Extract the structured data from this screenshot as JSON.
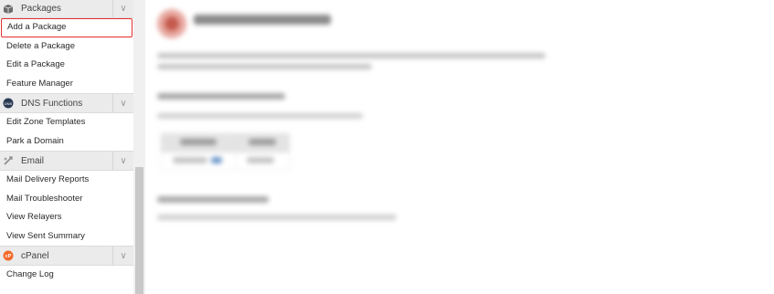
{
  "sidebar": {
    "sections": [
      {
        "id": "packages",
        "title": "Packages",
        "icon": "package-icon",
        "items": [
          "Add a Package",
          "Delete a Package",
          "Edit a Package",
          "Feature Manager"
        ],
        "active_item": "Add a Package"
      },
      {
        "id": "dns",
        "title": "DNS Functions",
        "icon": "dns-icon",
        "items": [
          "Edit Zone Templates",
          "Park a Domain"
        ]
      },
      {
        "id": "email",
        "title": "Email",
        "icon": "email-icon",
        "items": [
          "Mail Delivery Reports",
          "Mail Troubleshooter",
          "View Relayers",
          "View Sent Summary"
        ]
      },
      {
        "id": "cpanel",
        "title": "cPanel",
        "icon": "cpanel-icon",
        "items": [
          "Change Log"
        ]
      }
    ]
  },
  "colors": {
    "active_border": "#e4302e",
    "header_bg": "#ebebeb",
    "cpanel_orange": "#f26a2a"
  }
}
